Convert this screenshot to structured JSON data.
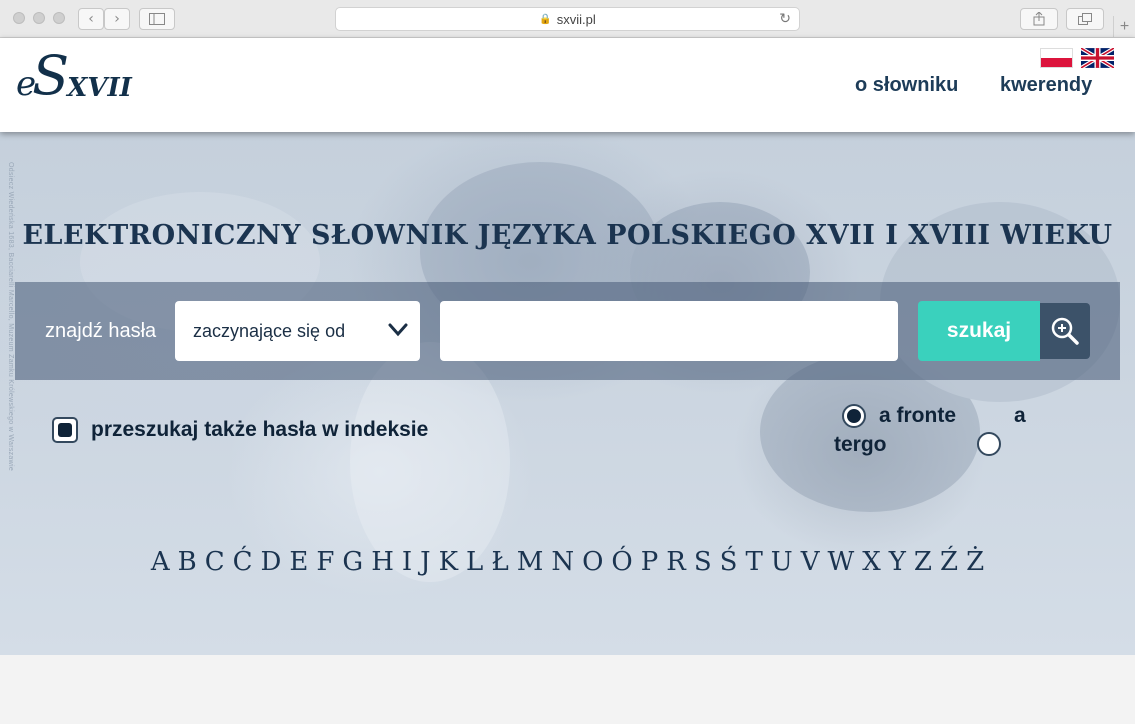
{
  "browser": {
    "url": "sxvii.pl"
  },
  "header": {
    "logo": {
      "e": "e",
      "s": "S",
      "xvii": "XVII"
    },
    "nav": [
      {
        "label": "o słowniku"
      },
      {
        "label": "kwerendy"
      }
    ],
    "languages": [
      "pl",
      "en"
    ]
  },
  "hero": {
    "side_credit": "Odsiecz Wiedeńska 1683, Bacciarelli Marcello, Muzeum Zamku Królewskiego w Warszawie",
    "title": "ELEKTRONICZNY SŁOWNIK JĘZYKA POLSKIEGO XVII I XVIII WIEKU",
    "search": {
      "label": "znajdź hasła",
      "mode_selected": "zaczynające się od",
      "query": "",
      "button": "szukaj"
    },
    "index_checkbox": {
      "label": "przeszukaj także hasła w indeksie",
      "checked": true
    },
    "direction": {
      "options": [
        {
          "label": "a fronte",
          "selected": true
        },
        {
          "label_line1": "a",
          "label_line2": "tergo",
          "selected": false
        }
      ]
    },
    "alphabet": [
      "A",
      "B",
      "C",
      "Ć",
      "D",
      "E",
      "F",
      "G",
      "H",
      "I",
      "J",
      "K",
      "L",
      "Ł",
      "M",
      "N",
      "O",
      "Ó",
      "P",
      "R",
      "S",
      "Ś",
      "T",
      "U",
      "V",
      "W",
      "X",
      "Y",
      "Z",
      "Ź",
      "Ż"
    ]
  },
  "colors": {
    "brand_navy": "#12304a",
    "search_button": "#3ad1bd",
    "icon_button": "#3c5269"
  }
}
